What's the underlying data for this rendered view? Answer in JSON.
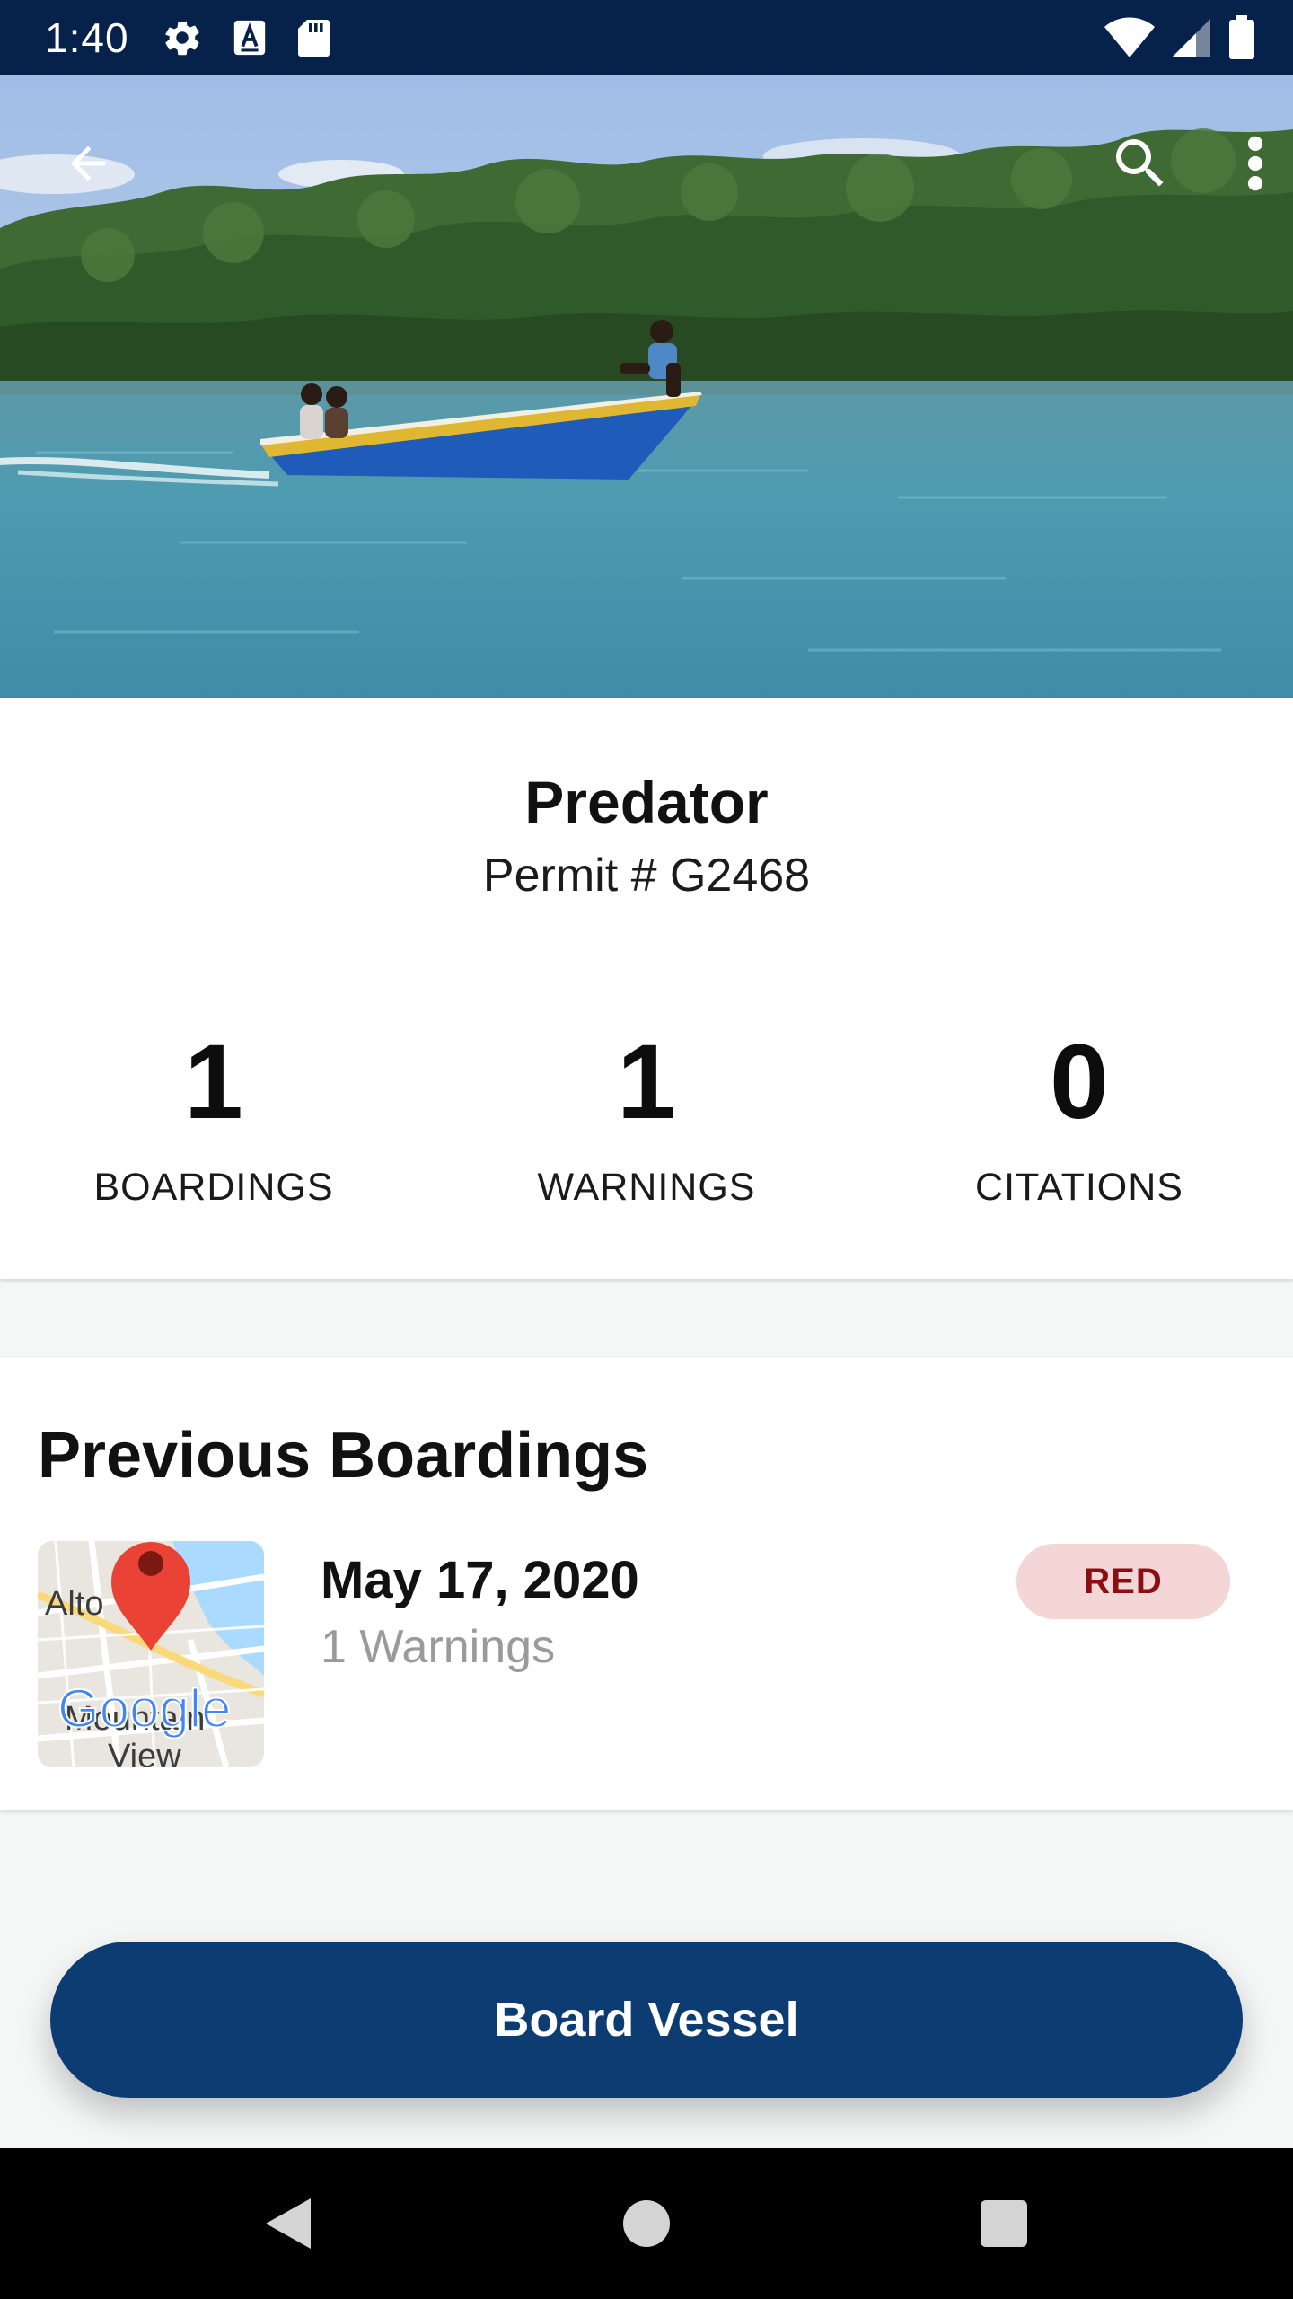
{
  "status_bar": {
    "time": "1:40",
    "left_icons": [
      "gear-icon",
      "text-a-icon",
      "sd-card-icon"
    ],
    "right_icons": [
      "wifi-icon",
      "signal-icon",
      "battery-icon"
    ],
    "bg_color": "#06224a"
  },
  "toolbar": {
    "back_icon": "arrow-left-icon",
    "search_icon": "search-icon",
    "menu_icon": "more-vert-icon"
  },
  "vessel": {
    "name": "Predator",
    "permit": "Permit # G2468"
  },
  "stats": [
    {
      "value": "1",
      "label": "BOARDINGS"
    },
    {
      "value": "1",
      "label": "WARNINGS"
    },
    {
      "value": "0",
      "label": "CITATIONS"
    }
  ],
  "previous_boardings": {
    "title": "Previous Boardings",
    "items": [
      {
        "date": "May 17, 2020",
        "warnings": "1 Warnings",
        "status": "RED",
        "map_labels": {
          "place_1": "Alto",
          "place_2": "Mountain",
          "place_3": "View",
          "brand": "Google"
        }
      }
    ]
  },
  "action": {
    "board_label": "Board Vessel",
    "color": "#0d3c73"
  },
  "nav_bar": {
    "icons": [
      "nav-back-icon",
      "nav-home-icon",
      "nav-recent-icon"
    ]
  }
}
